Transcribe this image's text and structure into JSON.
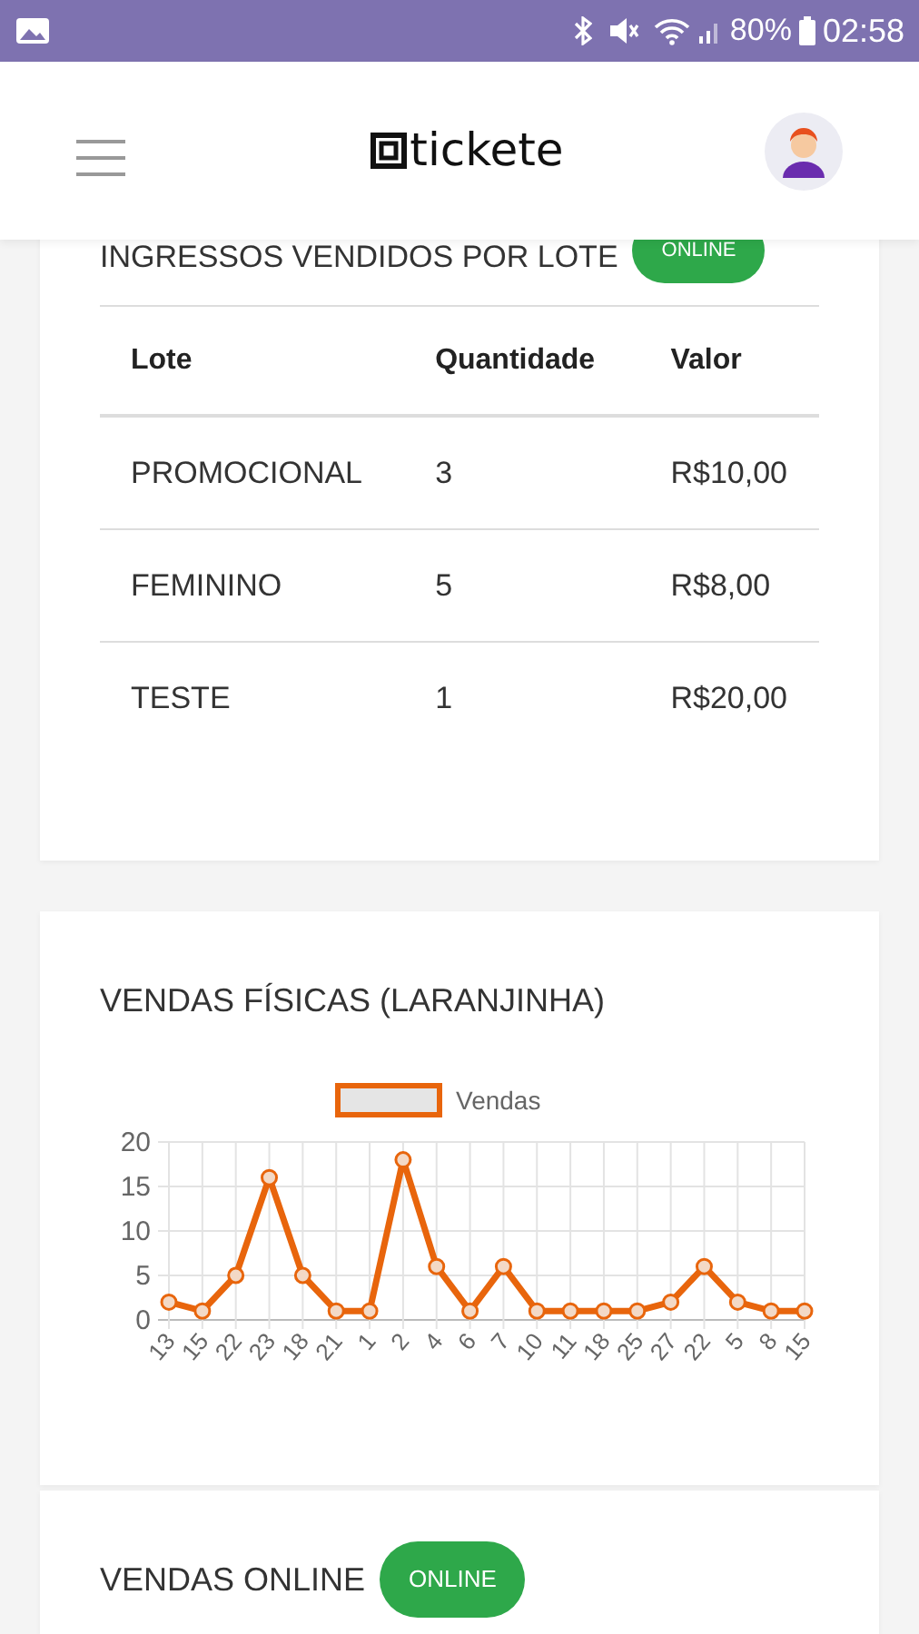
{
  "status_bar": {
    "battery": "80%",
    "time": "02:58"
  },
  "header": {
    "logo": "tickete"
  },
  "lotes_card": {
    "title": "INGRESSOS VENDIDOS POR LOTE",
    "badge": "ONLINE",
    "columns": [
      "Lote",
      "Quantidade",
      "Valor"
    ],
    "rows": [
      [
        "PROMOCIONAL",
        "3",
        "R$10,00"
      ],
      [
        "FEMININO",
        "5",
        "R$8,00"
      ],
      [
        "TESTE",
        "1",
        "R$20,00"
      ]
    ]
  },
  "fisicas_card": {
    "title": "VENDAS FÍSICAS (LARANJINHA)",
    "chart_data": {
      "type": "line",
      "categories": [
        "13",
        "15",
        "22",
        "23",
        "18",
        "21",
        "1",
        "2",
        "4",
        "6",
        "7",
        "10",
        "11",
        "18",
        "25",
        "27",
        "22",
        "5",
        "8",
        "15"
      ],
      "grid": true,
      "series": [
        {
          "name": "Vendas",
          "color": "#e8650c",
          "marker": "circle",
          "values": [
            2,
            1,
            5,
            16,
            5,
            1,
            1,
            18,
            6,
            1,
            6,
            1,
            1,
            1,
            1,
            2,
            6,
            2,
            1,
            1
          ]
        }
      ],
      "ylim": [
        0,
        20
      ],
      "yticks": [
        0,
        5,
        10,
        15,
        20
      ]
    }
  },
  "online_card": {
    "title": "VENDAS ONLINE",
    "badge": "ONLINE"
  }
}
